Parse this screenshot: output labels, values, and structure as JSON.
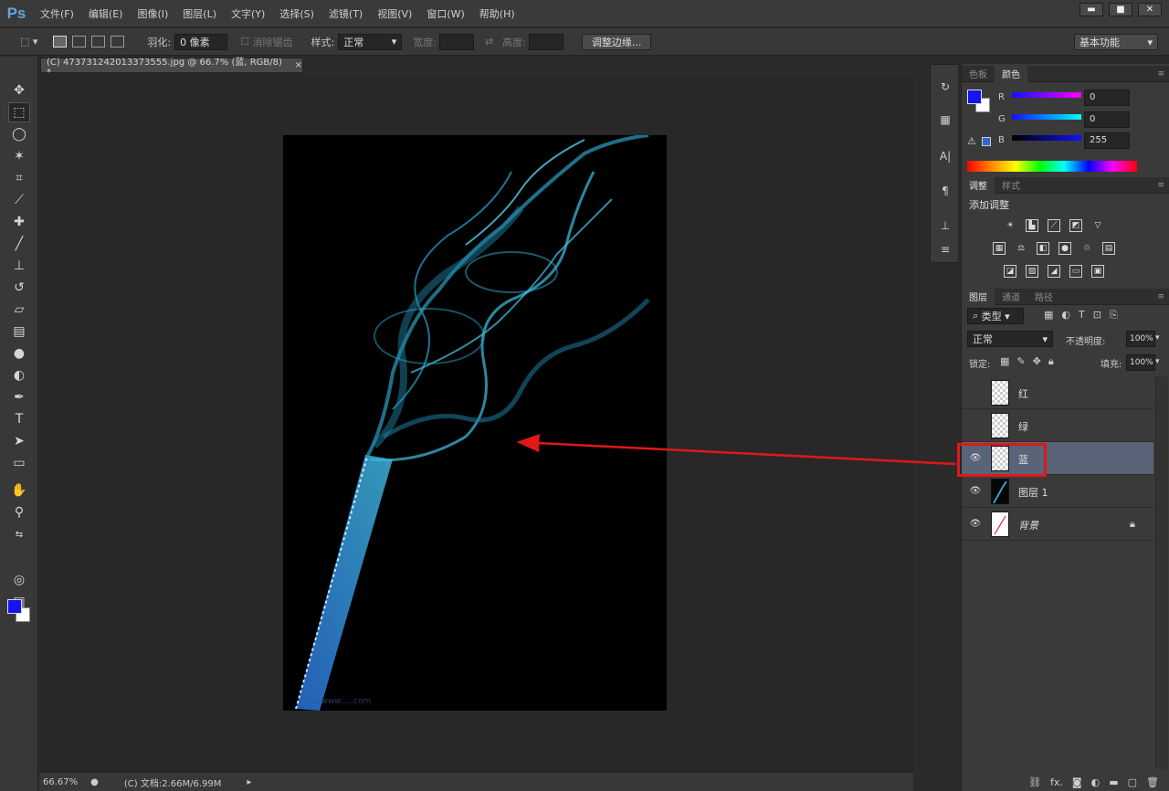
{
  "app": {
    "logo": "Ps"
  },
  "menu": [
    "文件(F)",
    "编辑(E)",
    "图像(I)",
    "图层(L)",
    "文字(Y)",
    "选择(S)",
    "滤镜(T)",
    "视图(V)",
    "窗口(W)",
    "帮助(H)"
  ],
  "window_controls": {
    "minimize": "▬",
    "maximize": "■",
    "close": "✕"
  },
  "options": {
    "feather_label": "羽化:",
    "feather_value": "0 像素",
    "antialias_label": "消除锯齿",
    "style_label": "样式:",
    "style_value": "正常",
    "width_label": "宽度:",
    "height_label": "高度:",
    "refine_button": "调整边缘...",
    "workspace": "基本功能"
  },
  "document": {
    "tab_title": "(C) 473731242013373555.jpg @ 66.7% (蓝, RGB/8) *",
    "watermark": "... www.....com",
    "zoom": "66.67%",
    "doc_info": "(C) 文档:2.66M/6.99M"
  },
  "color_panel": {
    "tabs": [
      "色板",
      "颜色"
    ],
    "active_tab": "颜色",
    "channels": [
      {
        "label": "R",
        "value": "0"
      },
      {
        "label": "G",
        "value": "0"
      },
      {
        "label": "B",
        "value": "255"
      }
    ],
    "foreground": "#1414f0",
    "background": "#ffffff"
  },
  "adjustments_panel": {
    "tabs": [
      "调整",
      "样式"
    ],
    "active_tab": "调整",
    "title": "添加调整"
  },
  "layers_panel": {
    "tabs": [
      "图层",
      "通道",
      "路径"
    ],
    "active_tab": "图层",
    "filter_kind": "类型",
    "blend_mode": "正常",
    "opacity_label": "不透明度:",
    "opacity_value": "100%",
    "lock_label": "锁定:",
    "fill_label": "填充:",
    "fill_value": "100%",
    "layers": [
      {
        "name": "红",
        "visible": false,
        "thumb": "trans",
        "selected": false
      },
      {
        "name": "绿",
        "visible": false,
        "thumb": "trans",
        "selected": false
      },
      {
        "name": "蓝",
        "visible": true,
        "thumb": "trans",
        "selected": true
      },
      {
        "name": "图层 1",
        "visible": true,
        "thumb": "dark",
        "selected": false
      },
      {
        "name": "背景",
        "visible": true,
        "thumb": "bg",
        "selected": false,
        "locked": true
      }
    ],
    "footer_fx": "fx."
  },
  "annotation": {
    "color": "#e01818"
  }
}
